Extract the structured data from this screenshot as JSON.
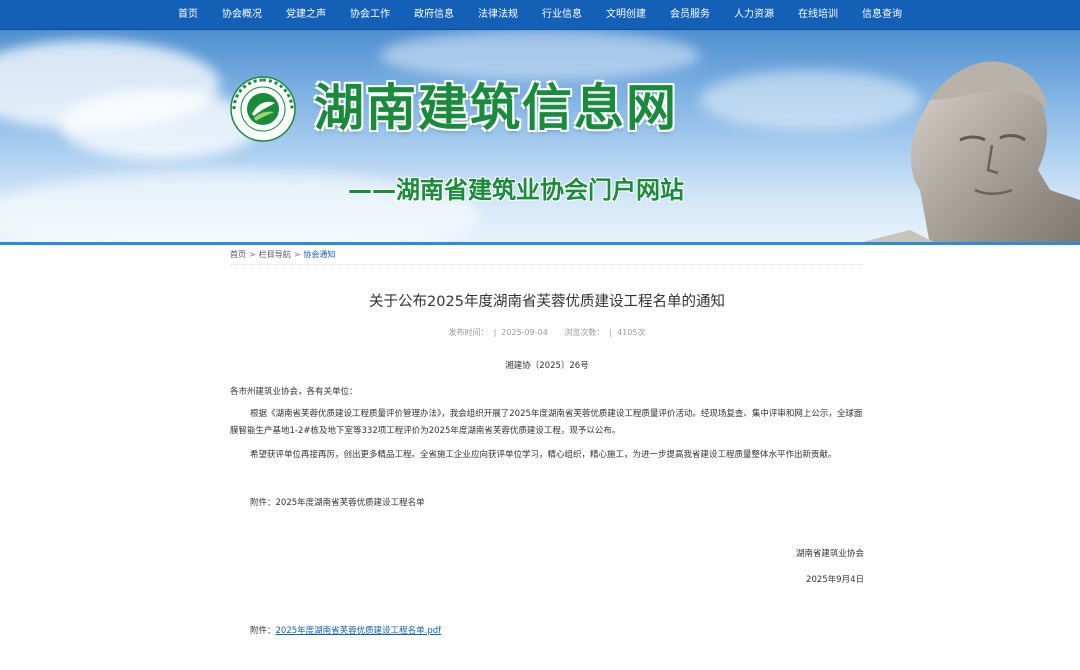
{
  "nav": {
    "items": [
      "首页",
      "协会概况",
      "党建之声",
      "协会工作",
      "政府信息",
      "法律法规",
      "行业信息",
      "文明创建",
      "会员服务",
      "人力资源",
      "在线培训",
      "信息查询"
    ]
  },
  "banner": {
    "title": "湖南建筑信息网",
    "subtitle": "——湖南省建筑业协会门户网站",
    "logo_icon": "association-logo-icon",
    "colors": {
      "title": "#1a8a3c",
      "nav": "#1560b7"
    }
  },
  "breadcrumb": {
    "home": "首页",
    "separator": ">",
    "section": "栏目导航",
    "current": "协会通知"
  },
  "article": {
    "title": "关于公布2025年度湖南省芙蓉优质建设工程名单的通知",
    "publish_label": "发布时间：",
    "publish_date": "2025-09-04",
    "views_label": "浏览次数：",
    "views": "4105次",
    "meta_separator": "|",
    "doc_number": "湘建协〔2025〕26号",
    "salutation": "各市州建筑业协会，各有关单位：",
    "paragraphs": [
      "根据《湖南省芙蓉优质建设工程质量评价管理办法》，我会组织开展了2025年度湖南省芙蓉优质建设工程质量评价活动。经现场复查、集中评审和网上公示，全球面膜智能生产基地1-2#栋及地下室等332项工程评价为2025年度湖南省芙蓉优质建设工程，现予以公布。",
      "希望获评单位再接再厉，创出更多精品工程。全省施工企业应向获评单位学习，精心组织，精心施工，为进一步提高我省建设工程质量整体水平作出新贡献。"
    ],
    "attachment_line": "附件：2025年度湖南省芙蓉优质建设工程名单",
    "signature_org": "湖南省建筑业协会",
    "signature_date": "2025年9月4日",
    "attachment_label": "附件：",
    "attachment_file": "2025年度湖南省芙蓉优质建设工程名单.pdf"
  }
}
